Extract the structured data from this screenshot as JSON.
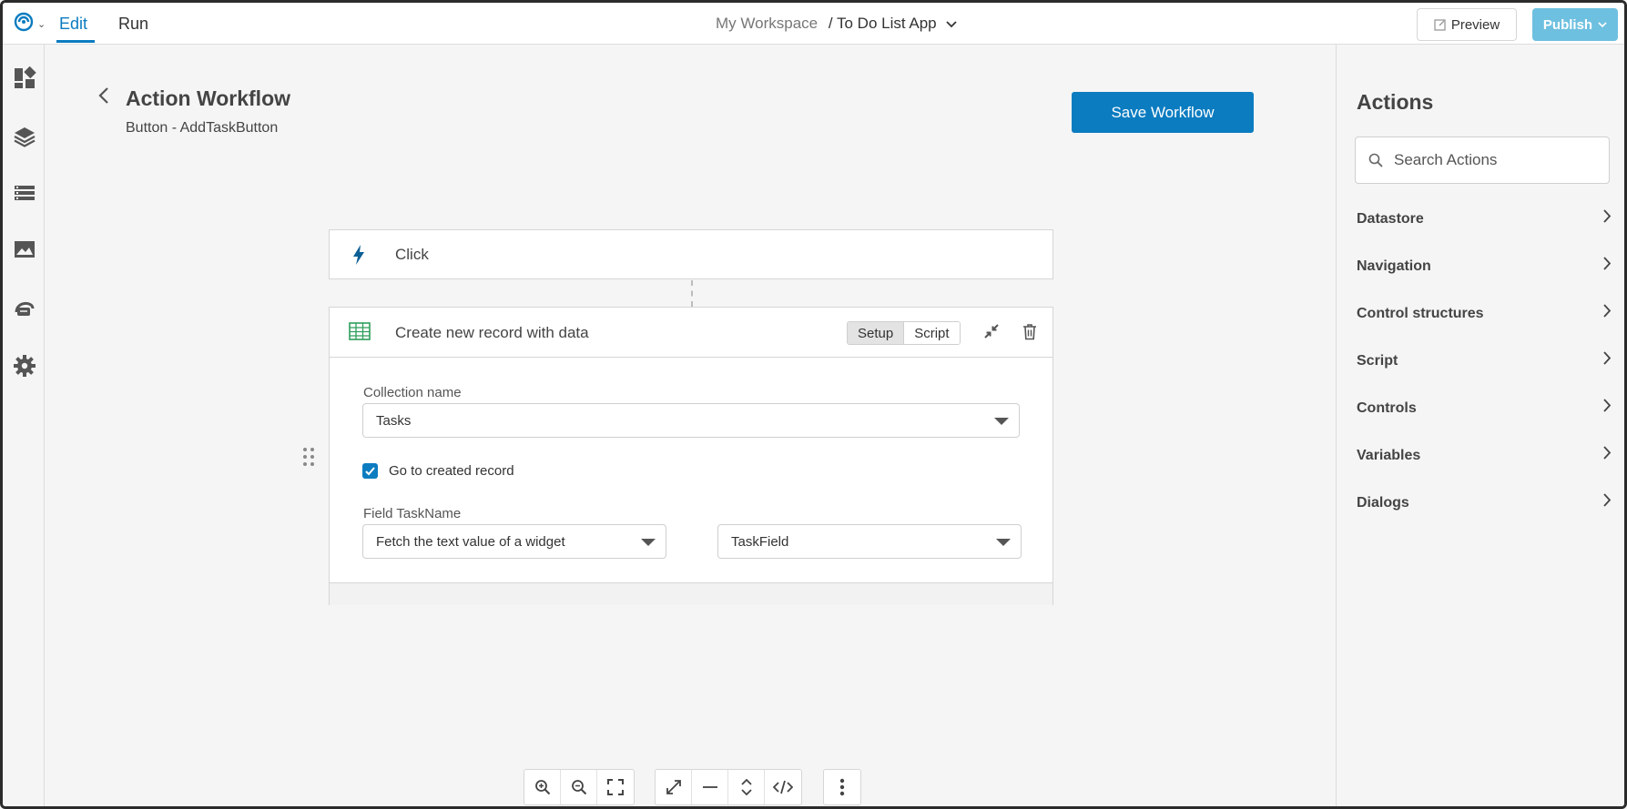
{
  "topbar": {
    "tabs": {
      "edit": "Edit",
      "run": "Run"
    },
    "breadcrumb": {
      "workspace": "My Workspace",
      "separator": "/",
      "app": "To Do List App"
    },
    "preview_label": "Preview",
    "publish_label": "Publish"
  },
  "left_rail": {
    "icons": [
      "widgets-icon",
      "layers-icon",
      "datastore-icon",
      "images-icon",
      "api-icon",
      "settings-icon"
    ]
  },
  "header": {
    "title": "Action Workflow",
    "subtitle": "Button - AddTaskButton",
    "save_label": "Save Workflow"
  },
  "workflow": {
    "trigger": {
      "label": "Click",
      "icon": "lightning-bolt-icon"
    },
    "action": {
      "label": "Create new record with data",
      "icon": "table-icon",
      "tabs": {
        "setup": "Setup",
        "script": "Script"
      },
      "active_tab": "Setup",
      "collection_label": "Collection name",
      "collection_value": "Tasks",
      "go_to_created_label": "Go to created record",
      "go_to_created_checked": true,
      "field_label": "Field TaskName",
      "field_source_value": "Fetch the text value of a widget",
      "field_widget_value": "TaskField"
    }
  },
  "actions_panel": {
    "title": "Actions",
    "search_placeholder": "Search Actions",
    "items": [
      "Datastore",
      "Navigation",
      "Control structures",
      "Script",
      "Controls",
      "Variables",
      "Dialogs"
    ]
  },
  "colors": {
    "accent": "#0b7cc0",
    "publish": "#6ec0e0",
    "table_icon": "#2e9e5b"
  }
}
